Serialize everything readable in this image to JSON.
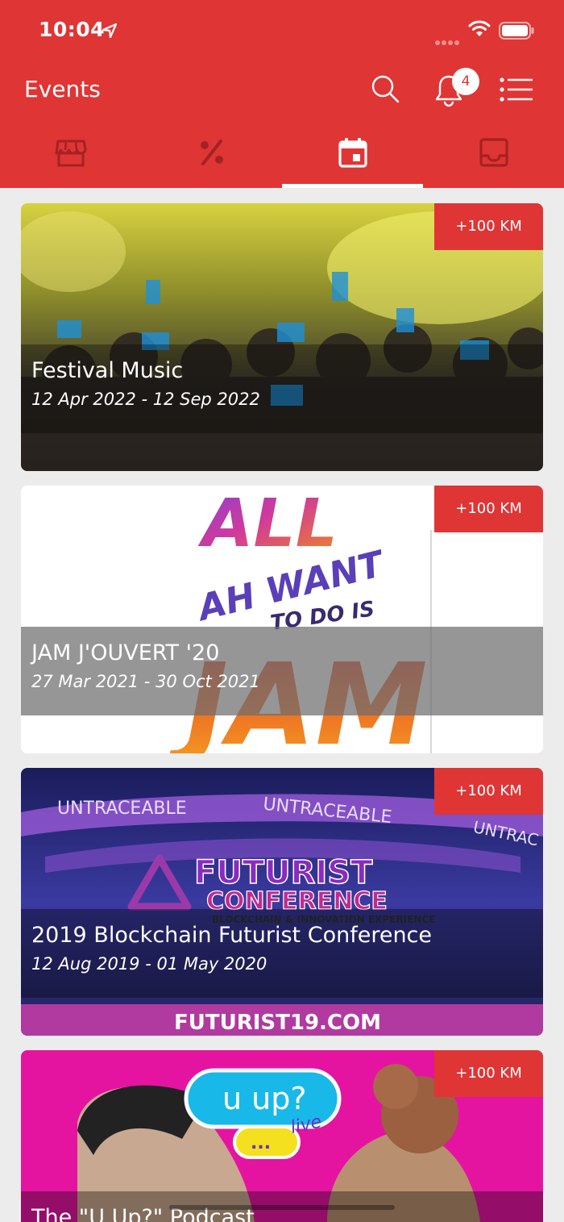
{
  "status_bar": {
    "time": "10:04"
  },
  "header": {
    "title": "Events",
    "notification_count": "4"
  },
  "tabs": [
    {
      "icon": "store-icon"
    },
    {
      "icon": "percent-icon"
    },
    {
      "icon": "calendar-icon",
      "active": true
    },
    {
      "icon": "inbox-icon"
    }
  ],
  "colors": {
    "accent": "#e03535"
  },
  "events": [
    {
      "name": "Festival Music",
      "dates": "12 Apr 2022 - 12 Sep 2022",
      "distance": "+100 KM"
    },
    {
      "name": "JAM J'OUVERT '20",
      "dates": "27 Mar 2021 - 30 Oct 2021",
      "distance": "+100 KM",
      "poster_text": [
        "ALL",
        "AH WANT",
        "TO DO IS",
        "JAM"
      ]
    },
    {
      "name": "2019 Blockchain Futurist Conference",
      "dates": "12 Aug 2019 - 01 May 2020",
      "distance": "+100 KM",
      "poster_text": [
        "UNTRACEABLE",
        "UNTRACEABLE",
        "UNTRAC",
        "FUTURIST",
        "CONFERENCE",
        "BLOCKCHAIN & INNOVATION EXPERIENCE",
        "FUTURIST19.COM"
      ]
    },
    {
      "name": "The \"U Up?\" Podcast",
      "dates": "",
      "distance": "+100 KM",
      "poster_text": [
        "u up?",
        "live",
        "..."
      ]
    }
  ]
}
